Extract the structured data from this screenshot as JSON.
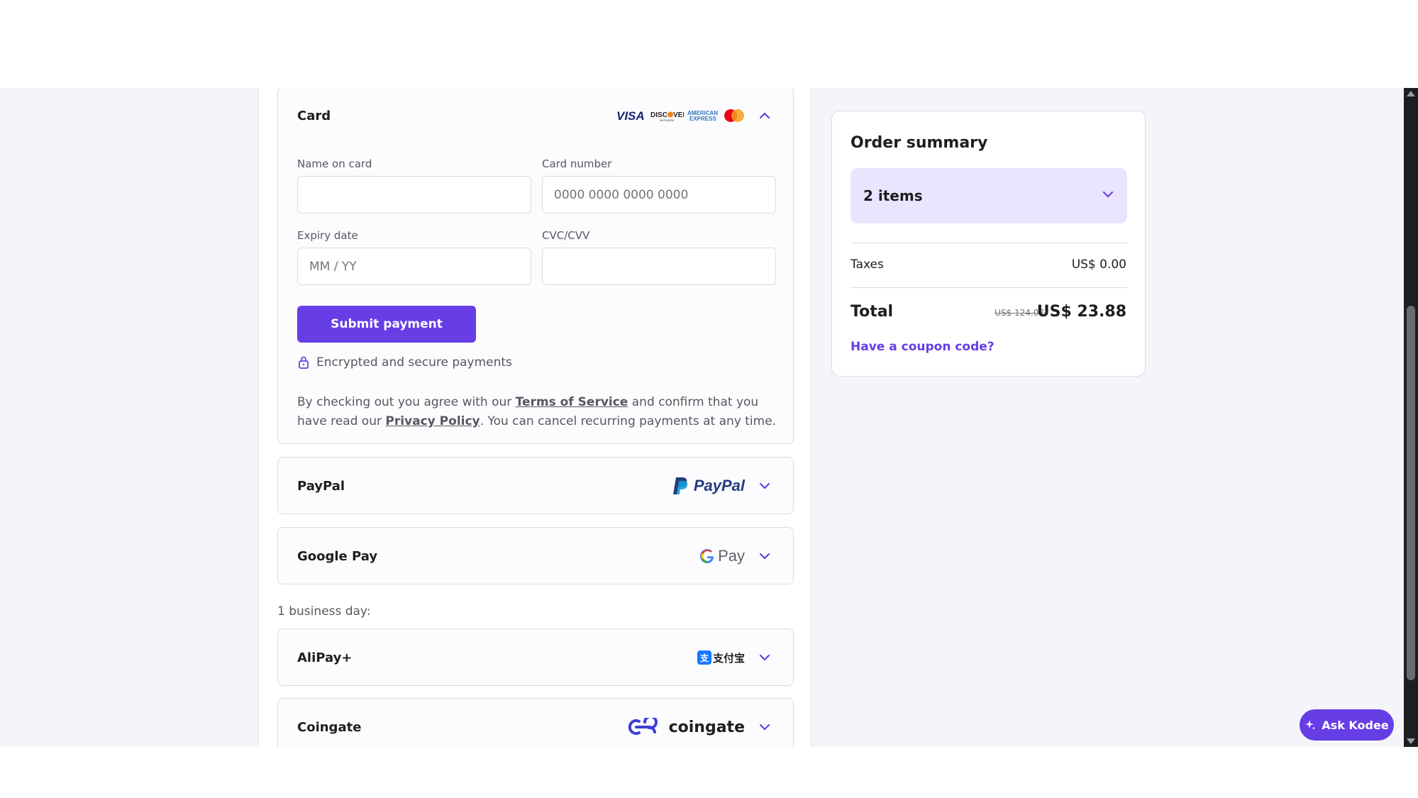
{
  "payment": {
    "card": {
      "title": "Card",
      "brands": [
        "VISA",
        "DISCOVER",
        "AMERICAN EXPRESS",
        "mastercard"
      ],
      "name_label": "Name on card",
      "name_value": "",
      "number_label": "Card number",
      "number_placeholder": "0000 0000 0000 0000",
      "expiry_label": "Expiry date",
      "expiry_placeholder": "MM / YY",
      "cvc_label": "CVC/CVV",
      "cvc_value": "",
      "submit_label": "Submit payment",
      "secure_text": "Encrypted and secure payments",
      "agree_prefix": "By checking out you agree with our ",
      "terms_link": "Terms of Service",
      "agree_middle": " and confirm that you have read our ",
      "privacy_link": "Privacy Policy",
      "agree_suffix": ". You can cancel recurring payments at any time."
    },
    "paypal": {
      "title": "PayPal",
      "logo_text": "PayPal"
    },
    "googlepay": {
      "title": "Google Pay",
      "logo_text": "Pay"
    },
    "business_day_label": "1 business day:",
    "alipay": {
      "title": "AliPay+",
      "logo_text": "支付宝"
    },
    "coingate": {
      "title": "Coingate",
      "logo_text": "coingate"
    }
  },
  "summary": {
    "title": "Order summary",
    "items_label": "2 items",
    "taxes_label": "Taxes",
    "taxes_value": "US$ 0.00",
    "total_label": "Total",
    "old_price": "US$ 124.07",
    "total_value": "US$ 23.88",
    "coupon_label": "Have a coupon code?"
  },
  "assistant": {
    "label": "Ask Kodee"
  },
  "colors": {
    "accent": "#673de6",
    "text": "#1d1e20",
    "muted": "#55585e",
    "border": "#dadce0",
    "accent_light": "#ebe4ff"
  }
}
